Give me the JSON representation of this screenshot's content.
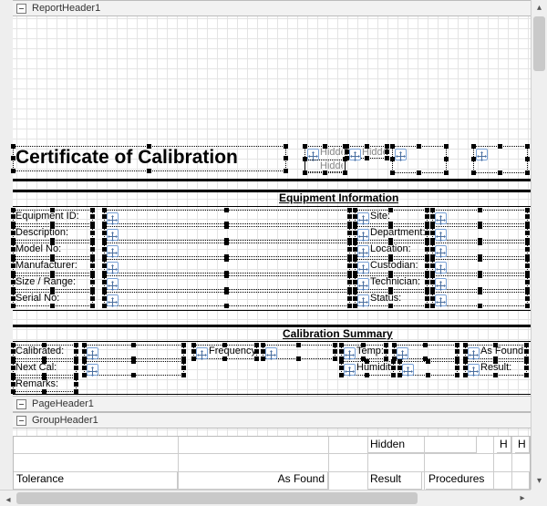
{
  "sections": {
    "report_header": "ReportHeader1",
    "page_header": "PageHeader1",
    "group_header": "GroupHeader1"
  },
  "title": "Certificate of Calibration",
  "hidden_labels": {
    "a": "Hidden",
    "b": "Hidden",
    "c": "Hidden"
  },
  "equip_header": "Equipment Information",
  "equip_left": {
    "equipment_id": "Equipment ID:",
    "description": "Description:",
    "model_no": "Model No:",
    "manufacturer": "Manufacturer:",
    "size_range": "Size / Range:",
    "serial_no": "Serial No:"
  },
  "equip_right": {
    "site": "Site:",
    "department": "Department:",
    "location": "Location:",
    "custodian": "Custodian:",
    "technician": "Technician:",
    "status": "Status:"
  },
  "cal_header": "Calibration Summary",
  "cal": {
    "calibrated": "Calibrated:",
    "next_cal": "Next Cal:",
    "remarks": "Remarks:",
    "frequency": "Frequency:",
    "temp": "Temp:",
    "humidity": "Humidity:",
    "as_found": "As Found:",
    "result": "Result:"
  },
  "detail": {
    "hidden": "Hidden",
    "h1": "H",
    "h2": "H",
    "tolerance": "Tolerance",
    "as_found": "As Found",
    "result": "Result",
    "procedures": "Procedures"
  }
}
